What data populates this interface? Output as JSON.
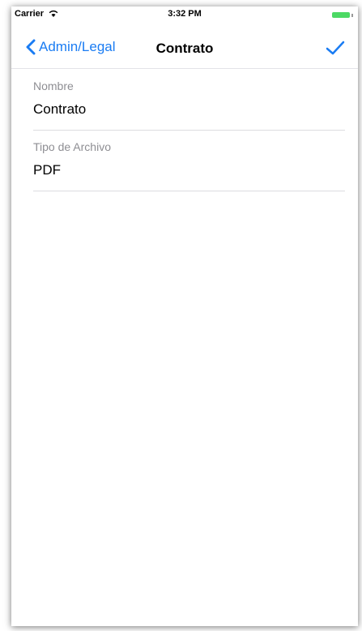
{
  "status_bar": {
    "carrier": "Carrier",
    "time": "3:32 PM",
    "battery_color": "#4cd964"
  },
  "nav": {
    "back_label": "Admin/Legal",
    "title": "Contrato",
    "accent_color": "#1a7cf3",
    "back_icon": "chevron-left-icon",
    "confirm_icon": "checkmark-icon"
  },
  "form": {
    "fields": [
      {
        "label": "Nombre",
        "value": "Contrato"
      },
      {
        "label": "Tipo de Archivo",
        "value": "PDF"
      }
    ]
  }
}
